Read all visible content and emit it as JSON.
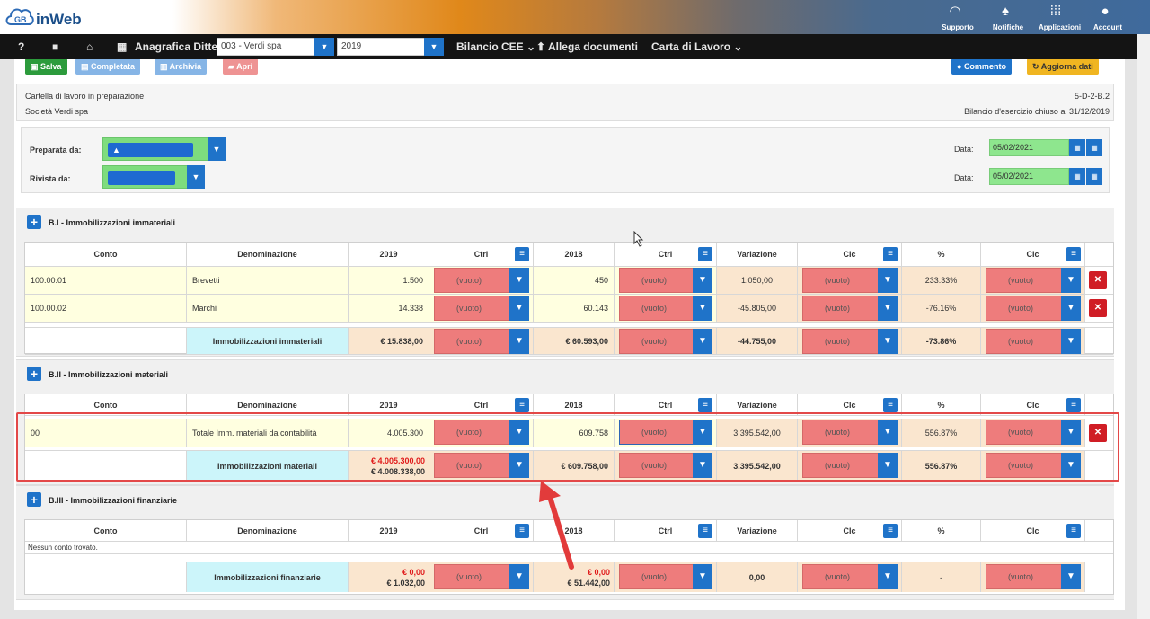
{
  "header": {
    "logo_text": "inWeb",
    "icons": [
      {
        "name": "headset-icon",
        "glyph": "◠",
        "label": "Supporto"
      },
      {
        "name": "bell-icon",
        "glyph": "♠",
        "label": "Notifiche"
      },
      {
        "name": "apps-icon",
        "glyph": "⁞⁞⁞",
        "label": "Applicazioni"
      },
      {
        "name": "account-icon",
        "glyph": "●",
        "label": "Account"
      }
    ]
  },
  "nav": {
    "help": "?",
    "video": "■",
    "home": "⌂",
    "building": "▦",
    "anagrafica_label": "Anagrafica Ditte",
    "company_value": "003 - Verdi spa",
    "year_value": "2019",
    "bilancio": "Bilancio CEE",
    "allega": "Allega documenti",
    "carta": "Carta di Lavoro",
    "caret": "⌄",
    "chev": "▼"
  },
  "toolbar": {
    "salva": "Salva",
    "completata": "Completata",
    "archivia": "Archivia",
    "apri": "Apri",
    "commento": "Commento",
    "aggiorna": "Aggiorna dati"
  },
  "info": {
    "status": "Cartella di lavoro in preparazione",
    "company": "Società Verdi spa",
    "code": "5-D-2-B.2",
    "closing": "Bilancio d'esercizio chiuso al 31/12/2019"
  },
  "people": {
    "preparata_label": "Preparata da:",
    "rivista_label": "Rivista da:",
    "data_label": "Data:",
    "preparata_date": "05/02/2021",
    "rivista_date": "05/02/2021"
  },
  "headers": {
    "conto": "Conto",
    "denominazione": "Denominazione",
    "y1": "2019",
    "ctrl": "Ctrl",
    "y2": "2018",
    "variazione": "Variazione",
    "clc": "Clc",
    "pct": "%"
  },
  "dd_value": "(vuoto)",
  "sections": [
    {
      "title": "B.I - Immobilizzazioni immateriali",
      "rows": [
        {
          "conto": "100.00.01",
          "den": "Brevetti",
          "v2019": "1.500",
          "v2018": "450",
          "var": "1.050,00",
          "pct": "233.33%"
        },
        {
          "conto": "100.00.02",
          "den": "Marchi",
          "v2019": "14.338",
          "v2018": "60.143",
          "var": "-45.805,00",
          "pct": "-76.16%"
        }
      ],
      "total": {
        "label": "Immobilizzazioni immateriali",
        "v2019": "€ 15.838,00",
        "v2018": "€ 60.593,00",
        "var": "-44.755,00",
        "pct": "-73.86%"
      }
    },
    {
      "title": "B.II - Immobilizzazioni materiali",
      "rows": [
        {
          "conto": "00",
          "den": "Totale Imm. materiali da contabilità",
          "v2019": "4.005.300",
          "v2018": "609.758",
          "var": "3.395.542,00",
          "pct": "556.87%"
        }
      ],
      "total": {
        "label": "Immobilizzazioni materiali",
        "v2019_red": "€ 4.005.300,00",
        "v2019": "€ 4.008.338,00",
        "v2018": "€ 609.758,00",
        "var": "3.395.542,00",
        "pct": "556.87%"
      }
    },
    {
      "title": "B.III - Immobilizzazioni finanziarie",
      "empty": "Nessun conto trovato.",
      "total": {
        "label": "Immobilizzazioni finanziarie",
        "v2019_red": "€ 0,00",
        "v2019": "€ 1.032,00",
        "v2018_red": "€ 0,00",
        "v2018": "€ 51.442,00",
        "var": "0,00",
        "pct": "-"
      }
    }
  ],
  "colors": {
    "accent": "#1f73c9",
    "highlight": "#e34848",
    "dropdown": "#ee7c7c"
  }
}
